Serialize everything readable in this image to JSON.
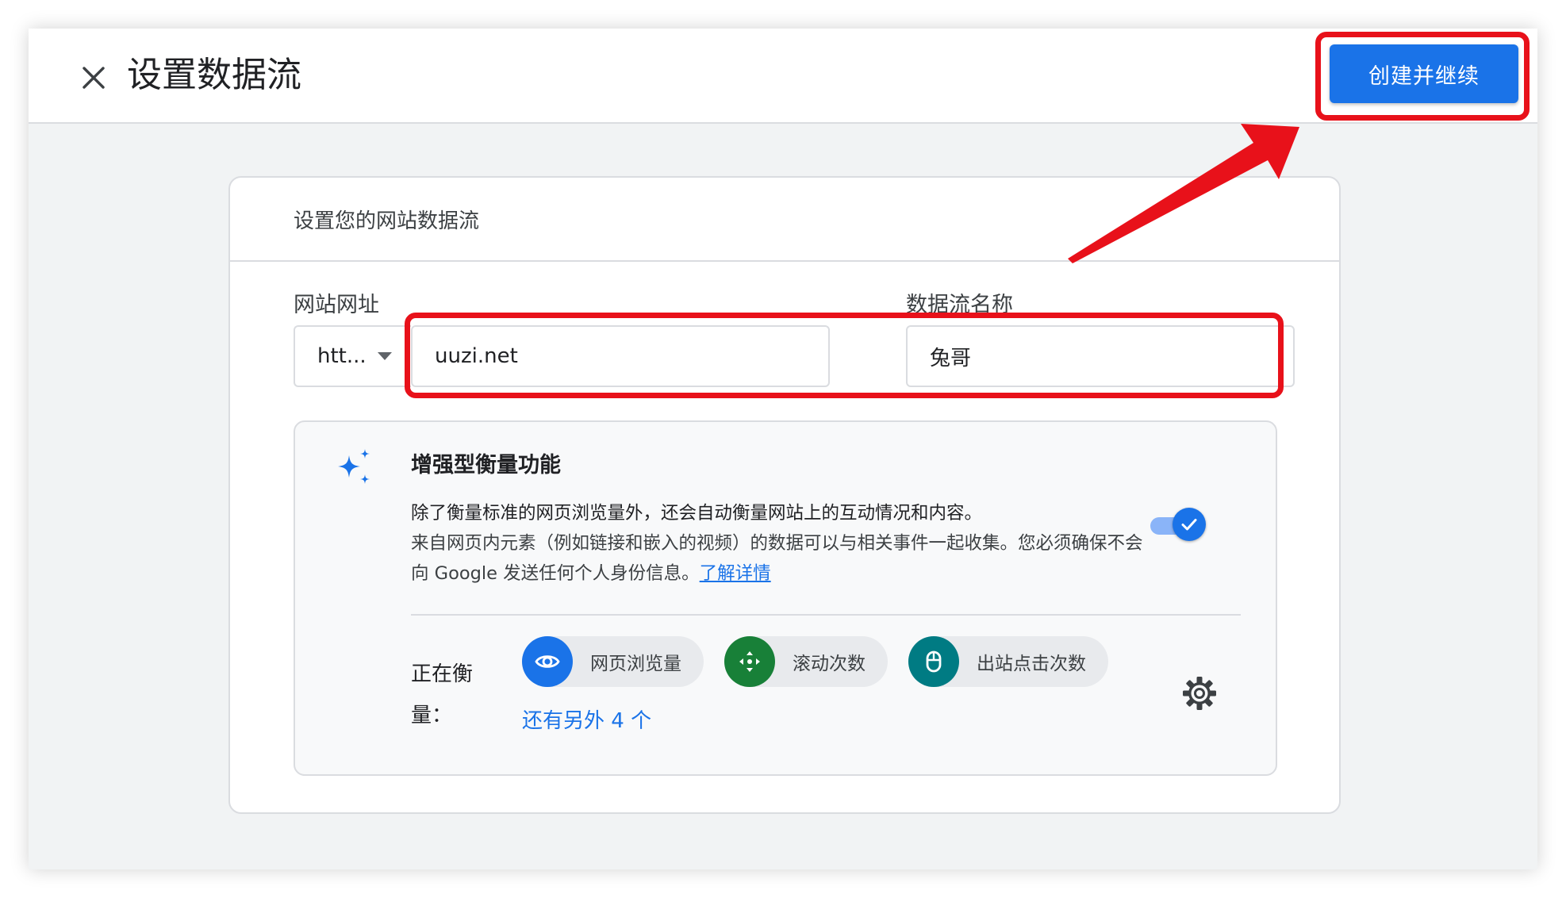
{
  "header": {
    "title": "设置数据流",
    "primary_button_label": "创建并继续"
  },
  "card": {
    "heading": "设置您的网站数据流",
    "website_url_label": "网站网址",
    "protocol_value": "htt...",
    "url_value": "uuzi.net",
    "stream_name_label": "数据流名称",
    "stream_name_value": "兔哥"
  },
  "enhanced": {
    "title": "增强型衡量功能",
    "line1": "除了衡量标准的网页浏览量外，还会自动衡量网站上的互动情况和内容。",
    "line2": "来自网页内元素（例如链接和嵌入的视频）的数据可以与相关事件一起收集。您必须确保不会向 Google 发送任何个人身份信息。",
    "learn_more": "了解详情",
    "toggle_on": true,
    "measuring_label": "正在衡量：",
    "chips": [
      {
        "label": "网页浏览量",
        "icon": "eye-icon",
        "color": "#1a73e8"
      },
      {
        "label": "滚动次数",
        "icon": "scroll-arrows-icon",
        "color": "#188038"
      },
      {
        "label": "出站点击次数",
        "icon": "mouse-icon",
        "color": "#007b83"
      }
    ],
    "more_link": "还有另外 4 个"
  },
  "colors": {
    "accent": "#1a73e8",
    "annotation": "#e8111a"
  }
}
